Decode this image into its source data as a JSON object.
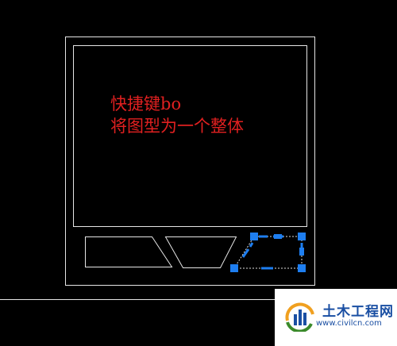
{
  "annotation": {
    "line1": "快捷键bo",
    "line2": "将图型为一个整体"
  },
  "watermark": {
    "title": "土木工程网",
    "url": "www.civilcn.com"
  },
  "colors": {
    "background": "#000000",
    "geometry": "#ffffff",
    "annotation_text": "#e02020",
    "grip": "#1e7ef0",
    "selection_dash": "#1e7ef0"
  }
}
